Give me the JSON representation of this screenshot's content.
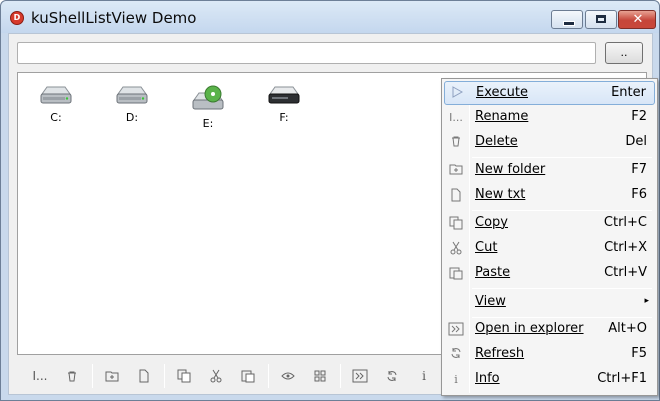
{
  "window": {
    "title": "kuShellListView Demo",
    "app_icon_text": "D",
    "close_glyph": "✕"
  },
  "path_bar": {
    "value": "",
    "placeholder": "",
    "browse_label": ".."
  },
  "drives": [
    {
      "label": "C:",
      "icon": "hard-drive-icon"
    },
    {
      "label": "D:",
      "icon": "hard-drive-icon"
    },
    {
      "label": "E:",
      "icon": "cd-drive-icon"
    },
    {
      "label": "F:",
      "icon": "removable-drive-icon"
    }
  ],
  "toolbar": {
    "icons": [
      "rename-icon",
      "delete-icon",
      "new-folder-icon",
      "new-file-icon",
      "copy-icon",
      "cut-icon",
      "paste-icon",
      "view-icon",
      "view-grid-icon",
      "open-in-explorer-icon",
      "refresh-icon",
      "info-icon"
    ],
    "glyphs": {
      "rename": "I...",
      "info": "i"
    }
  },
  "context_menu": {
    "items": [
      {
        "label": "Execute",
        "shortcut": "Enter",
        "icon": "execute-icon",
        "selected": true
      },
      {
        "label": "Rename",
        "shortcut": "F2",
        "icon": "rename-icon"
      },
      {
        "label": "Delete",
        "shortcut": "Del",
        "icon": "delete-icon"
      },
      {
        "label": "New folder",
        "shortcut": "F7",
        "icon": "new-folder-icon"
      },
      {
        "label": "New txt",
        "shortcut": "F6",
        "icon": "new-file-icon"
      },
      {
        "label": "Copy",
        "shortcut": "Ctrl+C",
        "icon": "copy-icon"
      },
      {
        "label": "Cut",
        "shortcut": "Ctrl+X",
        "icon": "cut-icon"
      },
      {
        "label": "Paste",
        "shortcut": "Ctrl+V",
        "icon": "paste-icon"
      },
      {
        "label": "View",
        "shortcut": "",
        "icon": "",
        "submenu": "▸"
      },
      {
        "label": "Open in explorer",
        "shortcut": "Alt+O",
        "icon": "open-in-explorer-icon"
      },
      {
        "label": "Refresh",
        "shortcut": "F5",
        "icon": "refresh-icon"
      },
      {
        "label": "Info",
        "shortcut": "Ctrl+F1",
        "icon": "info-icon"
      }
    ]
  },
  "colors": {
    "selection_border": "#84aed9",
    "close_button": "#c6463a",
    "title_bar": "#c4d7ee"
  }
}
